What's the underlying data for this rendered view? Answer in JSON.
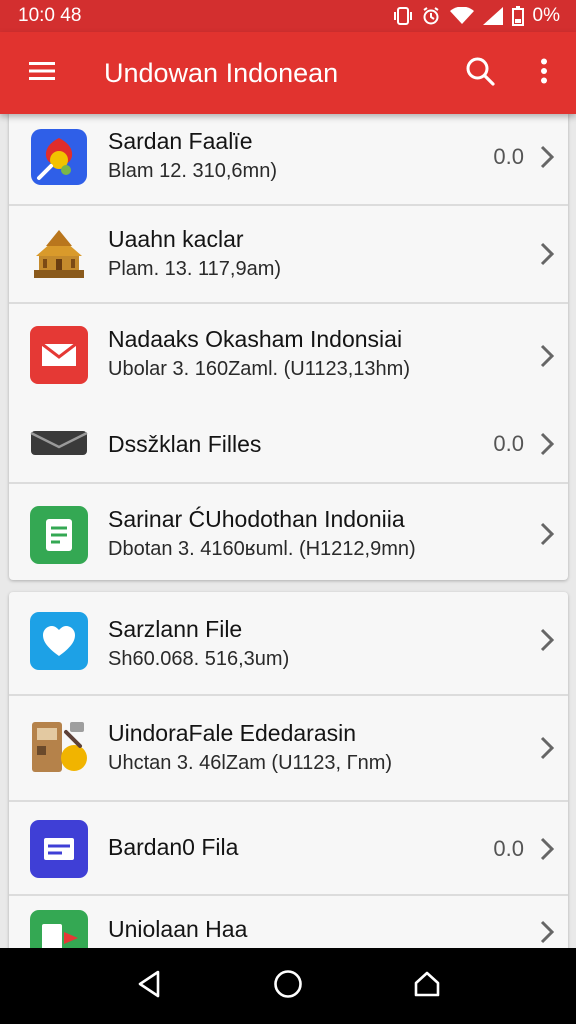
{
  "status_bar": {
    "time": "10:0 48",
    "battery": "0%"
  },
  "app_bar": {
    "title": "Undowan Indonean"
  },
  "cards": [
    {
      "items": [
        {
          "icon": "search-app-icon",
          "title": "Sardan Faalїe",
          "subtitle": "Blam 12. 310,6mn)",
          "size": "0.0"
        },
        {
          "icon": "temple-icon",
          "title": "Uaahn kaclar",
          "subtitle": "Plam. 13. 117,9am)",
          "size": ""
        },
        {
          "icon": "mail-icon",
          "title": "Nadaaks Okasham Indonsiai",
          "subtitle": "Ubolar 3. 160Zaml. (U1123,13hm)",
          "size": ""
        },
        {
          "icon": "envelope-icon",
          "title": "Dssžklan Filles",
          "subtitle": "",
          "size": "0.0"
        },
        {
          "icon": "document-icon",
          "title": "Sarinar ĆUhodothan Indoniia",
          "subtitle": "Dbotan 3. 4160ʁuml. (H1212,9mn)",
          "size": ""
        }
      ]
    },
    {
      "items": [
        {
          "icon": "heart-chat-icon",
          "title": "Sarzlann File",
          "subtitle": "Sh60.068. 516,3um)",
          "size": ""
        },
        {
          "icon": "tools-icon",
          "title": "UindoraFale Ededarasin",
          "subtitle": "Uhctan 3. 46ƖZam  (U1123, Γnm)",
          "size": ""
        },
        {
          "icon": "card-icon",
          "title": "Bardan0 Fila",
          "subtitle": "",
          "size": "0.0"
        },
        {
          "icon": "flag-doc-icon",
          "title": "Uniolaan Haa",
          "subtitle": "",
          "size": ""
        }
      ]
    }
  ],
  "colors": {
    "accent": "#e1332f",
    "status_bar": "#d32f2f",
    "nav_bar": "#000000"
  }
}
